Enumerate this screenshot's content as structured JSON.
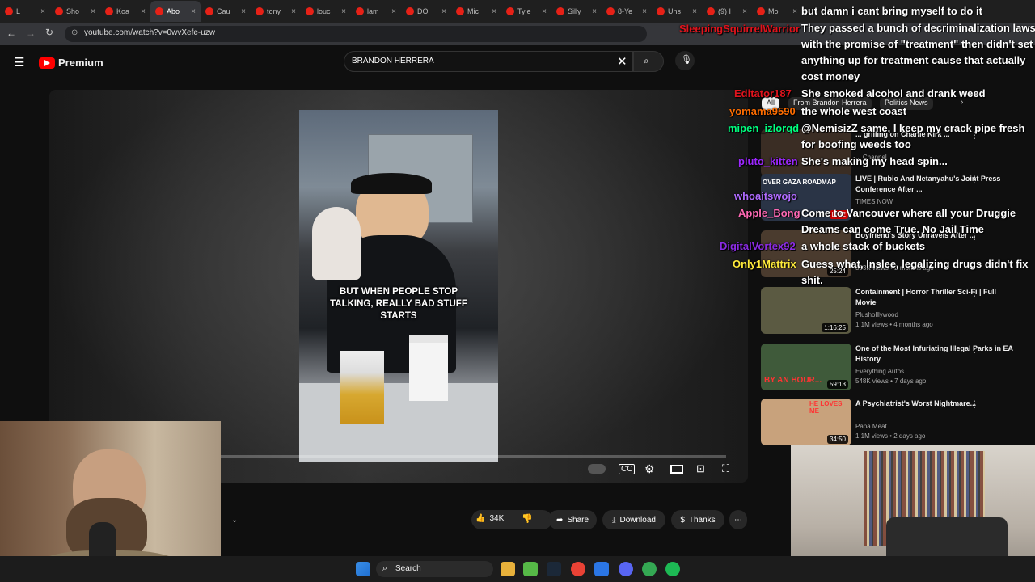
{
  "tabs": [
    {
      "label": "L"
    },
    {
      "label": "Sho"
    },
    {
      "label": "Koa"
    },
    {
      "label": "Abo"
    },
    {
      "label": "Cau"
    },
    {
      "label": "tony"
    },
    {
      "label": "louc"
    },
    {
      "label": "lam"
    },
    {
      "label": "DO"
    },
    {
      "label": "Mic"
    },
    {
      "label": "Tyle"
    },
    {
      "label": "Silly"
    },
    {
      "label": "8-Ye"
    },
    {
      "label": "Uns"
    },
    {
      "label": "(9) I"
    },
    {
      "label": "Mo"
    }
  ],
  "browser": {
    "url": "youtube.com/watch?v=0wvXefe-uzw"
  },
  "youtube": {
    "logo": "Premium",
    "search_value": "BRANDON HERRERA"
  },
  "filters": {
    "all": "All",
    "from": "From Brandon Herrera",
    "politics": "Politics News"
  },
  "video": {
    "caption": "BUT WHEN PEOPLE STOP TALKING, REALLY BAD STUFF STARTS",
    "likes": "34K",
    "share": "Share",
    "download": "Download",
    "thanks": "Thanks"
  },
  "recs": [
    {
      "title": "... grilling on Charlie Kirk ...",
      "sub": "... Channel",
      "views": "",
      "badge": ""
    },
    {
      "title": "LIVE | Rubio And Netanyahu's Joint Press Conference After ...",
      "sub": "TIMES NOW",
      "views": "",
      "badge": "LIVE"
    },
    {
      "title": "Boyfriend's Story Unravels After ...",
      "sub": "",
      "views": "353K views • 2 months ago",
      "badge": "",
      "dur": "25:24"
    },
    {
      "title": "Containment | Horror Thriller Sci-Fi | Full Movie",
      "sub": "Plusholllywood",
      "views": "1.1M views • 4 months ago",
      "dur": "1:16:25"
    },
    {
      "title": "One of the Most Infuriating Illegal Parks in EA History",
      "sub": "Everything Autos",
      "views": "548K views • 7 days ago",
      "dur": "59:13"
    },
    {
      "title": "A Psychiatrist's Worst Nightmare...",
      "sub": "Papa Meat",
      "views": "1.1M views • 2 days ago",
      "dur": "34:50"
    }
  ],
  "thumb_text": {
    "gaza": "OVER GAZA ROADMAP",
    "by_an_hour": "BY AN HOUR...",
    "he_loves_me": "HE LOVES ME"
  },
  "chat": [
    {
      "user": "SleepingSquirrelWarrior",
      "color": "#e0141d",
      "text": ""
    },
    {
      "user": "",
      "color": "#ffffff",
      "text": "but damn i cant bring myself to do it"
    },
    {
      "user": "",
      "color": "#ffffff",
      "text": "They passed a bunch of decriminalization laws"
    },
    {
      "user": "",
      "color": "#ffffff",
      "text": "with the promise of \"treatment\" then didn't set"
    },
    {
      "user": "",
      "color": "#ffffff",
      "text": "anything up for treatment cause that actually"
    },
    {
      "user": "",
      "color": "#ffffff",
      "text": "cost money"
    },
    {
      "user": "Editator187",
      "color": "#e0141d",
      "text": "She smoked alcohol and drank weed"
    },
    {
      "user": "yomama9590",
      "color": "#ff6d00",
      "text": "the whole west coast"
    },
    {
      "user": "mipen_izlorqd",
      "color": "#00ff7f",
      "text": "@NemisizZ same, I keep my crack pipe fresh"
    },
    {
      "user": "",
      "color": "#ffffff",
      "text": "for boofing weeds too"
    },
    {
      "user": "pluto_kitten",
      "color": "#9c27ff",
      "text": "She's making my head spin..."
    },
    {
      "user": "whoaitswojo",
      "color": "#b06bff",
      "text": ""
    },
    {
      "user": "Apple_Bong",
      "color": "#ff69b4",
      "text": "Come to Vancouver where all your Druggie"
    },
    {
      "user": "",
      "color": "#ffffff",
      "text": "Dreams can come True. No Jail Time"
    },
    {
      "user": "DigitalVortex92",
      "color": "#8a2be2",
      "text": "a whole stack of buckets"
    },
    {
      "user": "Only1Mattrix",
      "color": "#ffeb3b",
      "text": "Guess what, Inslee, legalizing drugs didn't fix"
    },
    {
      "user": "",
      "color": "#ffffff",
      "text": "shit."
    }
  ],
  "taskbar": {
    "search": "Search"
  },
  "colors": {
    "brand": "#ff0000",
    "bg": "#0f0f0f"
  }
}
